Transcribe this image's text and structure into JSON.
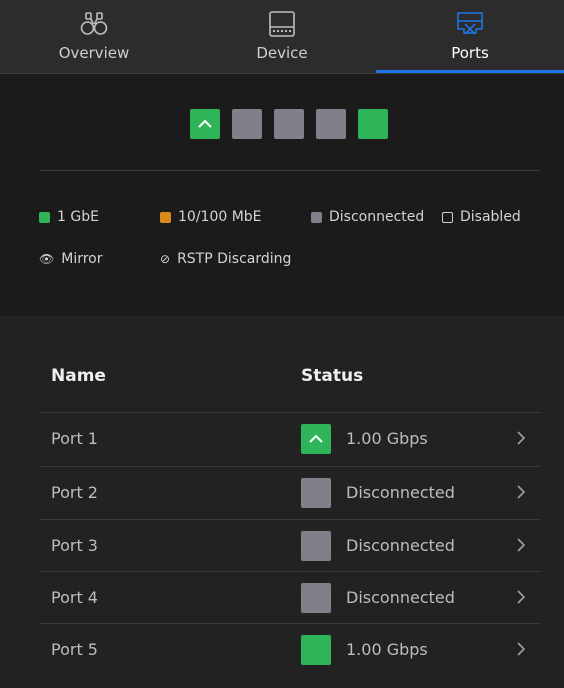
{
  "tabs": [
    {
      "label": "Overview",
      "icon": "binoculars-icon",
      "active": false
    },
    {
      "label": "Device",
      "icon": "device-icon",
      "active": false
    },
    {
      "label": "Ports",
      "icon": "ports-icon",
      "active": true
    }
  ],
  "colors": {
    "accent": "#1e74e6",
    "gbe": "#2fb45a",
    "mbe": "#d98c1b",
    "disconnected": "#80808a"
  },
  "port_strip": [
    {
      "state": "1gbe",
      "uplink": true
    },
    {
      "state": "disconnected",
      "uplink": false
    },
    {
      "state": "disconnected",
      "uplink": false
    },
    {
      "state": "disconnected",
      "uplink": false
    },
    {
      "state": "1gbe",
      "uplink": false
    }
  ],
  "legend": {
    "gbe": "1 GbE",
    "mbe": "10/100 MbE",
    "disconnected": "Disconnected",
    "disabled": "Disabled",
    "mirror": "Mirror",
    "rstp": "RSTP Discarding"
  },
  "table": {
    "headers": {
      "name": "Name",
      "status": "Status"
    },
    "rows": [
      {
        "name": "Port 1",
        "status": "1.00 Gbps",
        "state": "1gbe",
        "uplink": true
      },
      {
        "name": "Port 2",
        "status": "Disconnected",
        "state": "disconnected",
        "uplink": false
      },
      {
        "name": "Port 3",
        "status": "Disconnected",
        "state": "disconnected",
        "uplink": false
      },
      {
        "name": "Port 4",
        "status": "Disconnected",
        "state": "disconnected",
        "uplink": false
      },
      {
        "name": "Port 5",
        "status": "1.00 Gbps",
        "state": "1gbe",
        "uplink": false
      }
    ]
  }
}
